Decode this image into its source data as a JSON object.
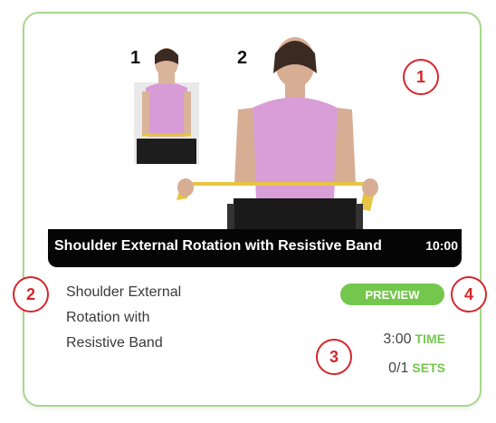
{
  "exercise": {
    "caption": "Shoulder External Rotation with Resistive Band",
    "duration": "10:00",
    "title_lines": [
      "Shoulder External",
      "Rotation with",
      "Resistive Band"
    ],
    "step_labels": [
      "1",
      "2"
    ],
    "preview_label": "PREVIEW",
    "time_value": "3:00",
    "time_unit": "TIME",
    "sets_value": "0/1",
    "sets_unit": "SETS"
  },
  "badges": [
    "1",
    "2",
    "3",
    "4"
  ],
  "colors": {
    "accent_green": "#74c74d",
    "card_border": "#a7d88c",
    "badge_red": "#d6262c",
    "caption_bg": "#050505"
  },
  "icons": {
    "exercise_image": "person-shoulder-rotation-photo"
  }
}
